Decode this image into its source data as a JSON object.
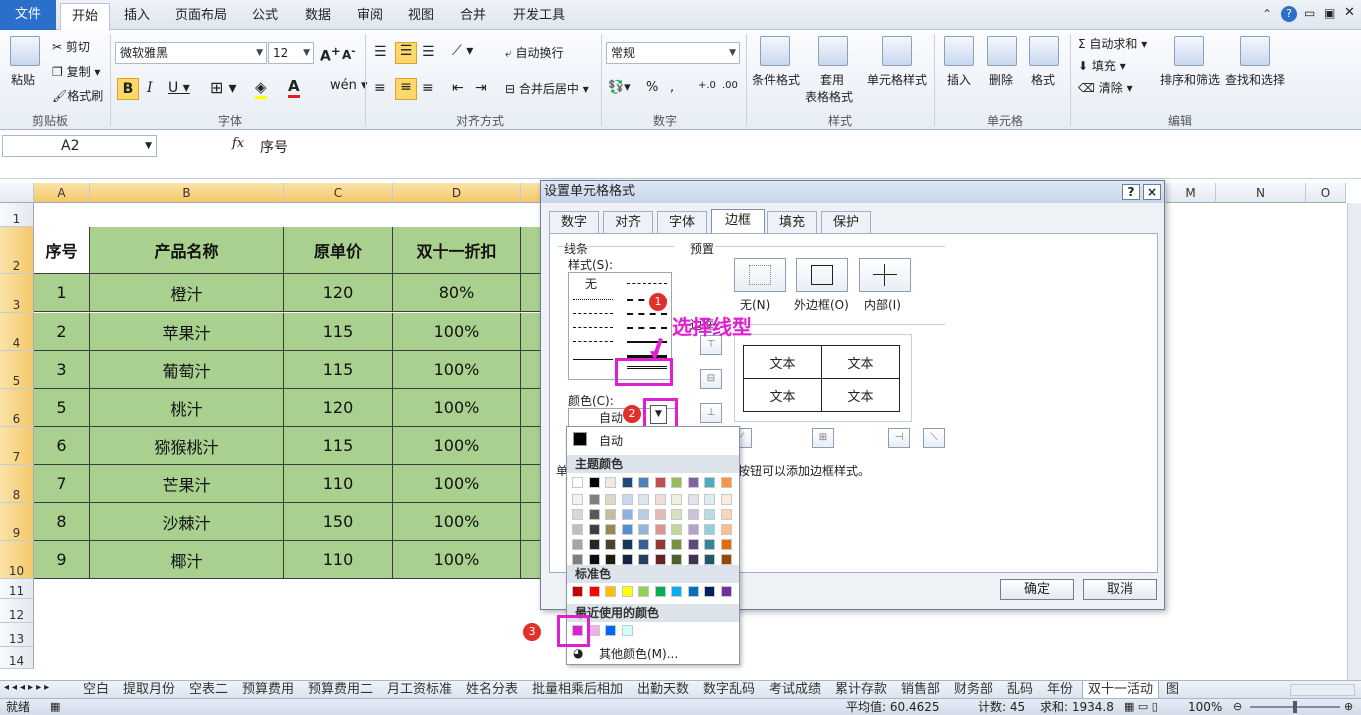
{
  "ribbon": {
    "tabs": [
      "文件",
      "开始",
      "插入",
      "页面布局",
      "公式",
      "数据",
      "审阅",
      "视图",
      "合并",
      "开发工具"
    ],
    "clipboard": {
      "paste": "粘贴",
      "cut": "剪切",
      "copy": "复制",
      "format_painter": "格式刷",
      "label": "剪贴板"
    },
    "font": {
      "name": "微软雅黑",
      "size": "12",
      "label": "字体"
    },
    "align": {
      "wrap": "自动换行",
      "merge": "合并后居中",
      "label": "对齐方式"
    },
    "number": {
      "format": "常规",
      "label": "数字"
    },
    "styles": {
      "cond": "条件格式",
      "table": "套用",
      "table2": "表格格式",
      "cellstyle": "单元格样式",
      "label": "样式"
    },
    "cells": {
      "insert": "插入",
      "delete": "删除",
      "format": "格式",
      "label": "单元格"
    },
    "edit": {
      "autosum": "自动求和",
      "fill": "填充",
      "clear": "清除",
      "sort": "排序和筛选",
      "find": "查找和选择",
      "label": "编辑"
    }
  },
  "formula_bar": {
    "cell_ref": "A2",
    "fx": "fx",
    "content": "序号"
  },
  "columns": [
    "A",
    "B",
    "C",
    "D",
    "M",
    "N",
    "O"
  ],
  "rows": [
    "1",
    "2",
    "3",
    "4",
    "5",
    "6",
    "7",
    "8",
    "9",
    "10",
    "11",
    "12",
    "13",
    "14"
  ],
  "table": {
    "headers": [
      "序号",
      "产品名称",
      "原单价",
      "双十一折扣"
    ],
    "rows": [
      [
        "1",
        "橙汁",
        "120",
        "80%"
      ],
      [
        "2",
        "苹果汁",
        "115",
        "100%"
      ],
      [
        "3",
        "葡萄汁",
        "115",
        "100%"
      ],
      [
        "5",
        "桃汁",
        "120",
        "100%"
      ],
      [
        "6",
        "猕猴桃汁",
        "115",
        "100%"
      ],
      [
        "7",
        "芒果汁",
        "110",
        "100%"
      ],
      [
        "8",
        "沙棘汁",
        "150",
        "100%"
      ],
      [
        "9",
        "椰汁",
        "110",
        "100%"
      ]
    ]
  },
  "dialog": {
    "title": "设置单元格格式",
    "help": "?",
    "close": "×",
    "tabs": [
      "数字",
      "对齐",
      "字体",
      "边框",
      "填充",
      "保护"
    ],
    "line_group": "线条",
    "style_label": "样式(S):",
    "none": "无",
    "color_label": "颜色(C):",
    "color_value": "自动",
    "preset_label": "预置",
    "preset_none": "无(N)",
    "preset_outline": "外边框(O)",
    "preset_inside": "内部(I)",
    "border_label": "边框",
    "preview_text": "文本",
    "hint": "单",
    "hint2": "按钮可以添加边框样式。",
    "ok": "确定",
    "cancel": "取消"
  },
  "annotation": {
    "text": "选择线型",
    "badges": [
      "1",
      "2",
      "3"
    ]
  },
  "palette": {
    "auto": "自动",
    "theme": "主题颜色",
    "standard": "标准色",
    "recent": "最近使用的颜色",
    "more": "其他颜色(M)...",
    "theme_top": [
      "#ffffff",
      "#000000",
      "#eeece1",
      "#1f497d",
      "#4f81bd",
      "#c0504d",
      "#9bbb59",
      "#8064a2",
      "#4bacc6",
      "#f79646"
    ],
    "theme_shades": [
      [
        "#f2f2f2",
        "#7f7f7f",
        "#ddd9c3",
        "#c6d9f0",
        "#dbe5f1",
        "#f2dcdb",
        "#ebf1dd",
        "#e5e0ec",
        "#dbeef3",
        "#fdeada"
      ],
      [
        "#d8d8d8",
        "#595959",
        "#c4bd97",
        "#8db3e2",
        "#b8cce4",
        "#e5b9b7",
        "#d7e3bc",
        "#ccc1d9",
        "#b7dde8",
        "#fbd5b5"
      ],
      [
        "#bfbfbf",
        "#3f3f3f",
        "#938953",
        "#548dd4",
        "#95b3d7",
        "#d99694",
        "#c3d69b",
        "#b2a2c7",
        "#92cddc",
        "#fac08f"
      ],
      [
        "#a5a5a5",
        "#262626",
        "#494429",
        "#17365d",
        "#366092",
        "#953734",
        "#76923c",
        "#5f497a",
        "#31859b",
        "#e36c09"
      ],
      [
        "#7f7f7f",
        "#0c0c0c",
        "#1d1b10",
        "#0f243e",
        "#244061",
        "#632423",
        "#4f6128",
        "#3f3151",
        "#205867",
        "#974806"
      ]
    ],
    "standard_colors": [
      "#c00000",
      "#ff0000",
      "#ffc000",
      "#ffff00",
      "#92d050",
      "#00b050",
      "#00b0f0",
      "#0070c0",
      "#002060",
      "#7030a0"
    ],
    "recent_colors": [
      "#e020d0",
      "#f0b0e8",
      "#0066ff",
      "#ccffff"
    ]
  },
  "sheet_tabs": [
    "空白",
    "提取月份",
    "空表二",
    "预算费用",
    "预算费用二",
    "月工资标准",
    "姓名分表",
    "批量相乘后相加",
    "出勤天数",
    "数字乱码",
    "考试成绩",
    "累计存款",
    "销售部",
    "财务部",
    "乱码",
    "年份",
    "双十一活动",
    "图"
  ],
  "status": {
    "ready": "就绪",
    "average": "平均值: 60.4625",
    "count": "计数: 45",
    "sum": "求和: 1934.8",
    "zoom": "100%"
  },
  "colors": {
    "accent": "#e020d0",
    "table_fill": "#a9d08e",
    "file_tab": "#2a6fc9"
  }
}
